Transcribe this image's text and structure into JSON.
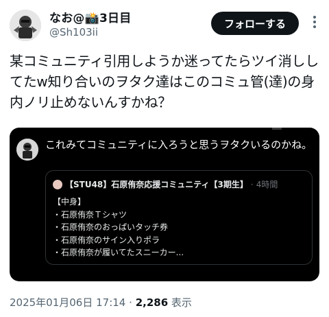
{
  "author": {
    "display_name": "なお@📸3日目",
    "handle": "@Sh103ii",
    "follow_label": "フォローする"
  },
  "tweet": {
    "text": "某コミュニティ引用しようか迷ってたらツイ消ししてたw知り合いのヲタク達はこのコミュ管(達)の身内ノリ止めないんすかね？"
  },
  "quoted": {
    "text": "これみてコミュニティに入ろうと思うヲタクいるのかね。",
    "community": {
      "name": "【STU48】石原侑奈応援コミュニティ【3期生】",
      "sep": "·",
      "time": "4時間",
      "lines": [
        "【中身】",
        "・石原侑奈Ｔシャツ",
        "・石原侑奈のおっぱいタッチ券",
        "・石原侑奈のサイン入りポラ",
        "・石原侑奈が履いてたスニーカー..."
      ]
    }
  },
  "meta": {
    "timestamp": "2025年01月06日 17:14",
    "sep": "·",
    "views_count": "2,286",
    "views_label": "表示"
  }
}
